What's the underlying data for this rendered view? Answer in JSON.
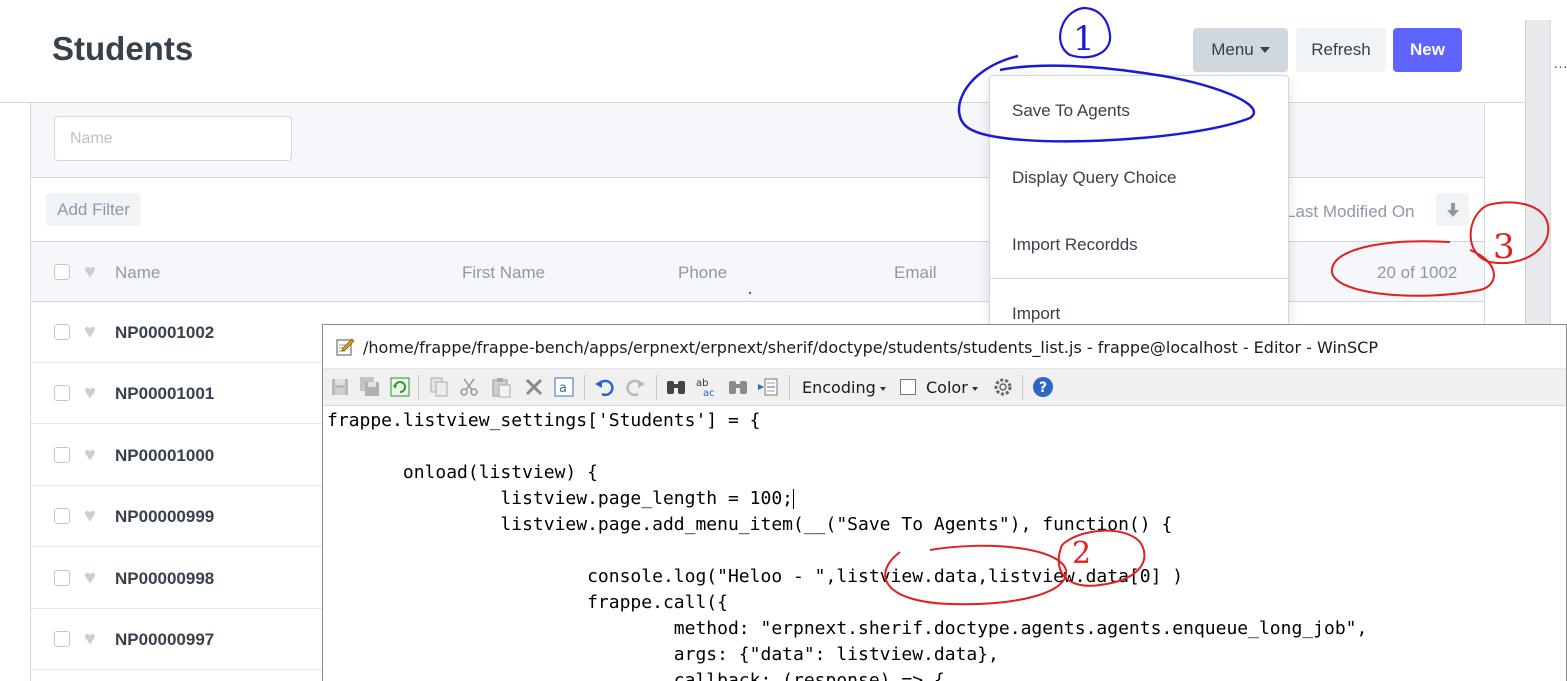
{
  "page": {
    "title": "Students",
    "buttons": {
      "menu": "Menu",
      "refresh": "Refresh",
      "new": "New"
    }
  },
  "filters": {
    "name_placeholder": "Name",
    "add_filter": "Add Filter",
    "sort_label": "Last Modified On",
    "sort_icon": "arrow-down-icon"
  },
  "list": {
    "columns": [
      "Name",
      "First Name",
      "Phone",
      "Email"
    ],
    "count": "20 of 1002",
    "rows": [
      "NP00001002",
      "NP00001001",
      "NP00001000",
      "NP00000999",
      "NP00000998",
      "NP00000997"
    ]
  },
  "menu_dropdown": {
    "items": [
      "Save To Agents",
      "Display Query Choice",
      "Import Recordds",
      "Import"
    ]
  },
  "editor": {
    "title": "/home/frappe/frappe-bench/apps/erpnext/erpnext/sherif/doctype/students/students_list.js - frappe@localhost - Editor - WinSCP",
    "toolbar": {
      "encoding": "Encoding",
      "color": "Color"
    },
    "code_lines": [
      "frappe.listview_settings['Students'] = {",
      "",
      "       onload(listview) {",
      "                listview.page_length = 100;",
      "                listview.page.add_menu_item(__(\"Save To Agents\"), function() {",
      "",
      "                        console.log(\"Heloo - \",listview.data,listview.data[0] )",
      "                        frappe.call({",
      "                                method: \"erpnext.sherif.doctype.agents.agents.enqueue_long_job\",",
      "                                args: {\"data\": listview.data},",
      "                                callback: (response) => {"
    ]
  },
  "annotations": {
    "marks": [
      "1",
      "2",
      "3"
    ],
    "colors": {
      "blue": "#1a1ad6",
      "red": "#e02020"
    }
  },
  "colors": {
    "primary": "#5e64ff",
    "text": "#36414c",
    "muted": "#8d99a6",
    "border": "#d1d8dd"
  }
}
